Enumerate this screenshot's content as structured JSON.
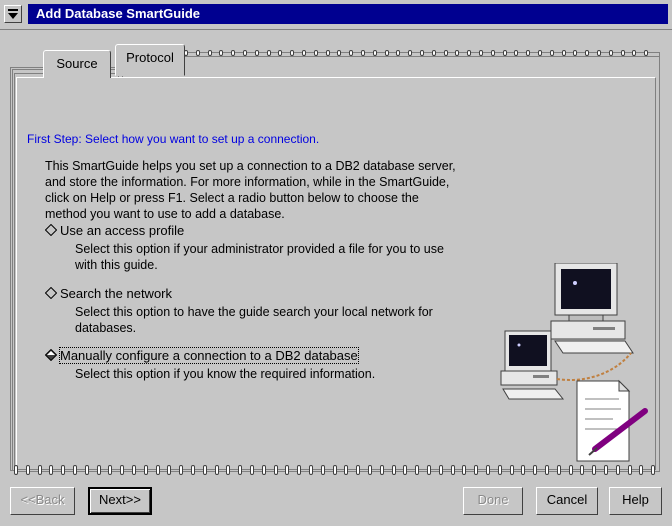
{
  "window": {
    "title": "Add Database SmartGuide"
  },
  "tabs": [
    {
      "label": "Source",
      "selected": true
    },
    {
      "label": "Protocol",
      "selected": false
    }
  ],
  "content": {
    "step_heading": "First Step: Select how you want to set up a connection.",
    "intro_lines": [
      "This SmartGuide helps you set up a connection to a DB2 database server,",
      "and store the information.  For more information, while in the SmartGuide,",
      "click on Help or press F1.  Select a radio button below to choose the",
      "method you want to use to add a database."
    ],
    "options": [
      {
        "label": "Use an access profile",
        "selected": false,
        "desc": [
          "Select this option if your administrator provided a file for you to use",
          "with this guide."
        ]
      },
      {
        "label": "Search the network",
        "selected": false,
        "desc": [
          "Select this option to have the guide search your local network for",
          "databases."
        ]
      },
      {
        "label": "Manually configure a connection to a DB2 database",
        "selected": true,
        "desc": [
          "Select this option if you know the required information."
        ]
      }
    ]
  },
  "buttons": {
    "back": "<<Back",
    "next": "Next>>",
    "done": "Done",
    "cancel": "Cancel",
    "help": "Help"
  },
  "colors": {
    "title_bar": "#000090",
    "step_heading": "#0000e0",
    "background": "#c6c6c6"
  }
}
